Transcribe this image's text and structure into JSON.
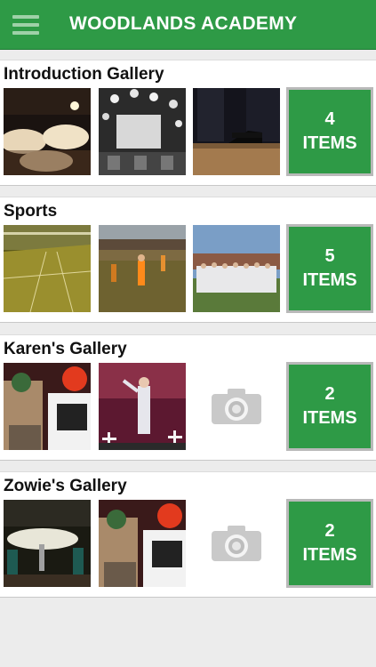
{
  "header": {
    "title": "WOODLANDS ACADEMY",
    "menu_icon": "hamburger-icon",
    "bg_color": "#2e9a46"
  },
  "galleries": [
    {
      "title": "Introduction Gallery",
      "count": "4",
      "unit": "ITEMS",
      "thumbnails": [
        "banquet-hall-photo",
        "party-balloons-photo",
        "stage-piano-photo"
      ]
    },
    {
      "title": "Sports",
      "count": "5",
      "unit": "ITEMS",
      "thumbnails": [
        "sports-hall-photo",
        "football-match-photo",
        "team-group-photo"
      ]
    },
    {
      "title": "Karen's Gallery",
      "count": "2",
      "unit": "ITEMS",
      "thumbnails": [
        "costume-performers-photo",
        "stage-performance-photo",
        "camera-placeholder-icon"
      ]
    },
    {
      "title": "Zowie's Gallery",
      "count": "2",
      "unit": "ITEMS",
      "thumbnails": [
        "dining-room-photo",
        "costume-performers-photo",
        "camera-placeholder-icon"
      ]
    }
  ]
}
